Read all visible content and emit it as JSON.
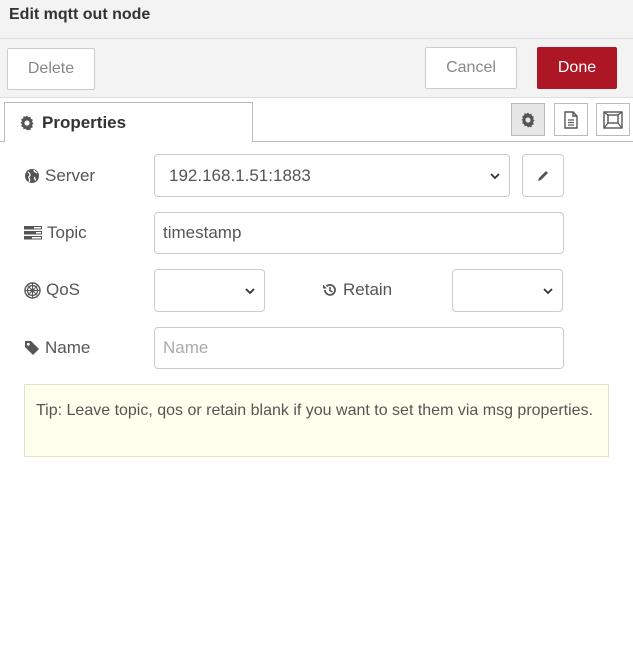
{
  "dialog": {
    "title": "Edit mqtt out node"
  },
  "buttons": {
    "delete": "Delete",
    "cancel": "Cancel",
    "done": "Done"
  },
  "tabs": {
    "properties": "Properties"
  },
  "form": {
    "server": {
      "label": "Server",
      "value": "192.168.1.51:1883"
    },
    "topic": {
      "label": "Topic",
      "value": "timestamp"
    },
    "qos": {
      "label": "QoS",
      "value": ""
    },
    "retain": {
      "label": "Retain",
      "value": ""
    },
    "name": {
      "label": "Name",
      "value": "",
      "placeholder": "Name"
    }
  },
  "tip": "Tip: Leave topic, qos or retain blank if you want to set them via msg properties.",
  "colors": {
    "done_bg": "#ad1625",
    "tip_bg": "#ffffee"
  }
}
